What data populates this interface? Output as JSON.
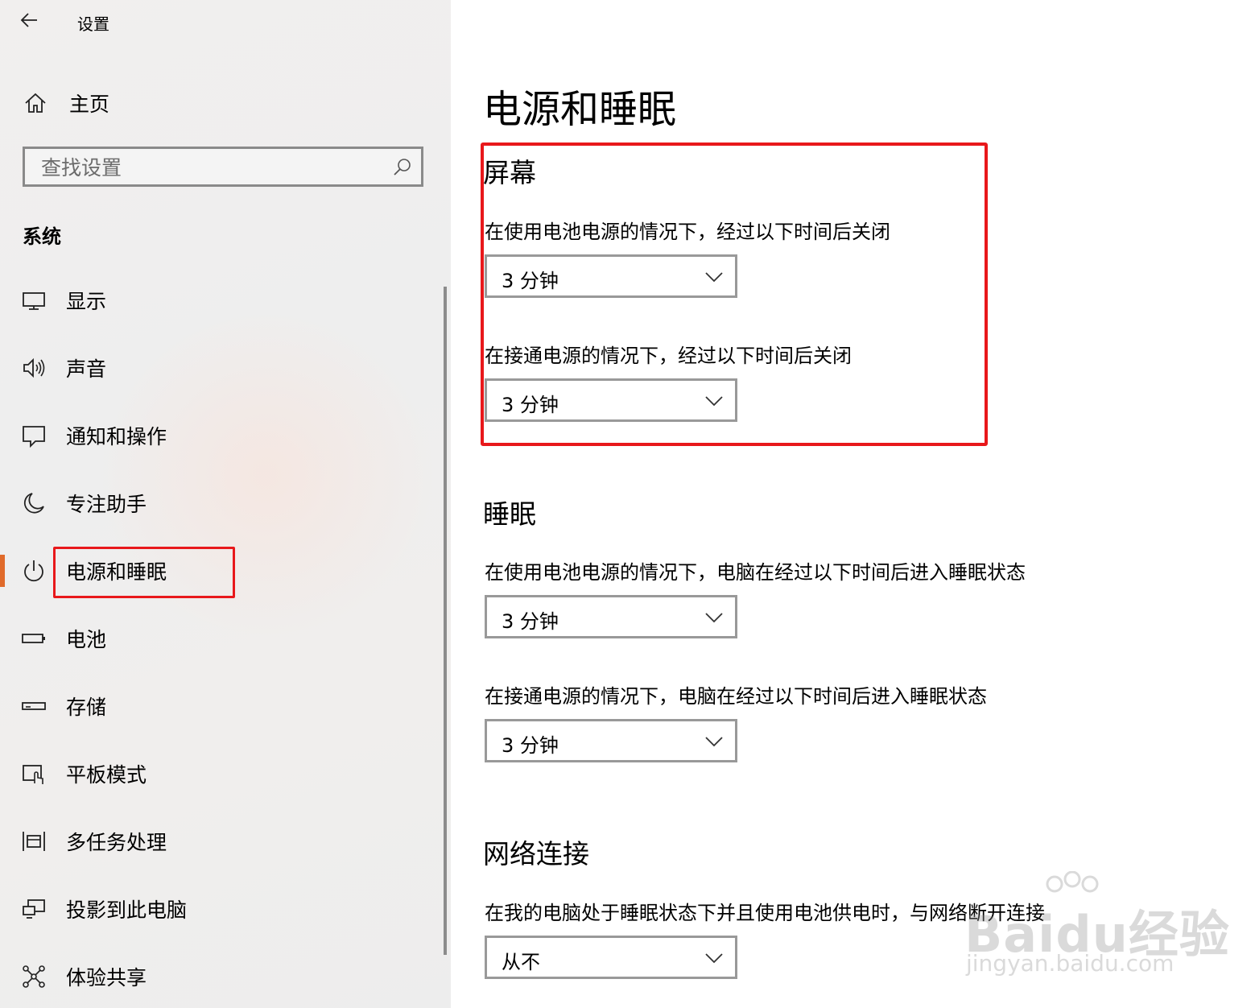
{
  "window": {
    "title": "设置"
  },
  "sidebar": {
    "home_label": "主页",
    "search_placeholder": "查找设置",
    "section_label": "系统",
    "items": [
      {
        "label": "显示",
        "icon": "monitor-icon"
      },
      {
        "label": "声音",
        "icon": "speaker-icon"
      },
      {
        "label": "通知和操作",
        "icon": "notification-icon"
      },
      {
        "label": "专注助手",
        "icon": "moon-icon"
      },
      {
        "label": "电源和睡眠",
        "icon": "power-icon",
        "active": true
      },
      {
        "label": "电池",
        "icon": "battery-icon"
      },
      {
        "label": "存储",
        "icon": "storage-icon"
      },
      {
        "label": "平板模式",
        "icon": "tablet-mode-icon"
      },
      {
        "label": "多任务处理",
        "icon": "multitasking-icon"
      },
      {
        "label": "投影到此电脑",
        "icon": "project-icon"
      },
      {
        "label": "体验共享",
        "icon": "share-icon"
      }
    ]
  },
  "main": {
    "title": "电源和睡眠",
    "screen": {
      "title": "屏幕",
      "battery_desc": "在使用电池电源的情况下，经过以下时间后关闭",
      "battery_value": "3 分钟",
      "plugged_desc": "在接通电源的情况下，经过以下时间后关闭",
      "plugged_value": "3 分钟"
    },
    "sleep": {
      "title": "睡眠",
      "battery_desc": "在使用电池电源的情况下，电脑在经过以下时间后进入睡眠状态",
      "battery_value": "3 分钟",
      "plugged_desc": "在接通电源的情况下，电脑在经过以下时间后进入睡眠状态",
      "plugged_value": "3 分钟"
    },
    "network": {
      "title": "网络连接",
      "battery_desc": "在我的电脑处于睡眠状态下并且使用电池供电时，与网络断开连接",
      "battery_value": "从不"
    }
  },
  "watermark": {
    "brand": "Baidu经验",
    "url": "jingyan.baidu.com"
  },
  "colors": {
    "accent": "#e06a2a",
    "highlight_red": "#e8181b"
  }
}
